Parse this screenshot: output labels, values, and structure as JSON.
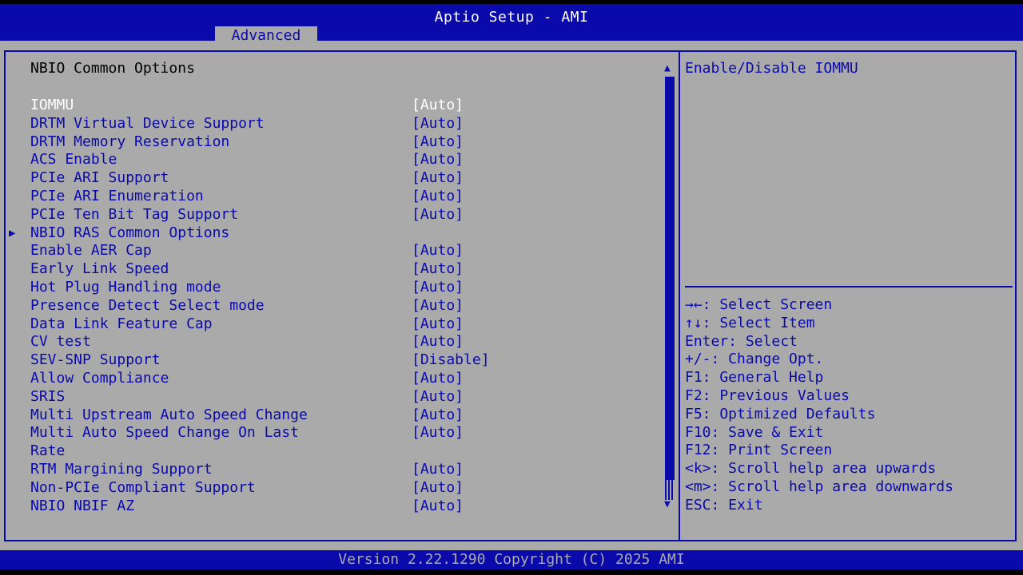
{
  "header": {
    "title": "Aptio Setup - AMI",
    "active_tab": "Advanced"
  },
  "page": {
    "section_title": "NBIO Common Options"
  },
  "items": [
    {
      "label": "IOMMU",
      "value": "[Auto]",
      "selected": true
    },
    {
      "label": "DRTM Virtual Device Support",
      "value": "[Auto]"
    },
    {
      "label": "DRTM Memory Reservation",
      "value": "[Auto]"
    },
    {
      "label": "ACS Enable",
      "value": "[Auto]"
    },
    {
      "label": "PCIe ARI Support",
      "value": "[Auto]"
    },
    {
      "label": "PCIe ARI Enumeration",
      "value": "[Auto]"
    },
    {
      "label": "PCIe Ten Bit Tag Support",
      "value": "[Auto]"
    },
    {
      "label": "NBIO RAS Common Options",
      "value": "",
      "submenu": true
    },
    {
      "label": "Enable AER Cap",
      "value": "[Auto]"
    },
    {
      "label": "Early Link Speed",
      "value": "[Auto]"
    },
    {
      "label": "Hot Plug Handling mode",
      "value": "[Auto]"
    },
    {
      "label": "Presence Detect Select mode",
      "value": "[Auto]"
    },
    {
      "label": "Data Link Feature Cap",
      "value": "[Auto]"
    },
    {
      "label": "CV test",
      "value": "[Auto]"
    },
    {
      "label": "SEV-SNP Support",
      "value": "[Disable]"
    },
    {
      "label": "Allow Compliance",
      "value": "[Auto]"
    },
    {
      "label": "SRIS",
      "value": "[Auto]"
    },
    {
      "label": "Multi Upstream Auto Speed Change",
      "value": "[Auto]"
    },
    {
      "label": "Multi Auto Speed Change On Last",
      "value": "[Auto]"
    },
    {
      "label": "Rate",
      "value": ""
    },
    {
      "label": "RTM Margining Support",
      "value": "[Auto]"
    },
    {
      "label": "Non-PCIe Compliant Support",
      "value": "[Auto]"
    },
    {
      "label": "NBIO NBIF AZ",
      "value": "[Auto]"
    }
  ],
  "help": {
    "description": "Enable/Disable IOMMU",
    "keys": [
      "→←: Select Screen",
      "↑↓: Select Item",
      "Enter: Select",
      "+/-: Change Opt.",
      "F1: General Help",
      "F2: Previous Values",
      "F5: Optimized Defaults",
      "F10: Save & Exit",
      "F12: Print Screen",
      "<k>: Scroll help area upwards",
      "<m>: Scroll help area downwards",
      "ESC: Exit"
    ]
  },
  "footer": {
    "version": "Version 2.22.1290 Copyright (C) 2025 AMI"
  },
  "colors": {
    "blue": "#0a0aaa",
    "gray": "#aaaaaa",
    "white": "#ffffff",
    "black": "#000000"
  }
}
